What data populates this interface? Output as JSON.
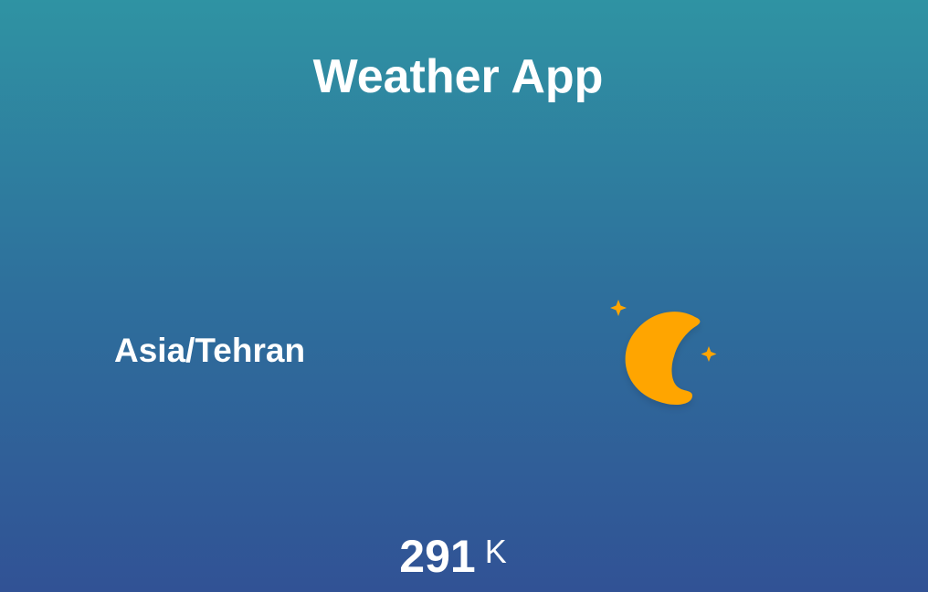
{
  "app": {
    "title": "Weather App"
  },
  "location": {
    "timezone": "Asia/Tehran"
  },
  "weather": {
    "icon": "moon-stars-icon",
    "icon_color": "#FFA500",
    "temperature": "291",
    "unit": "K"
  },
  "colors": {
    "background_top": "#2f93a3",
    "background_bottom": "#315295",
    "text": "#ffffff"
  }
}
